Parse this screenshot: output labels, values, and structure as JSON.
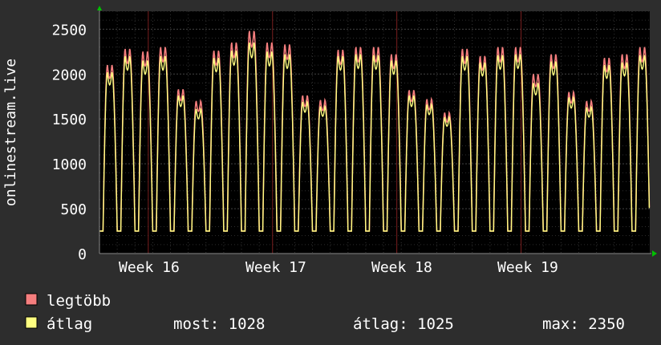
{
  "chart_data": {
    "type": "line",
    "ylabel": "onlinestream.live",
    "yticks": [
      0,
      500,
      1000,
      1500,
      2000,
      2500
    ],
    "ylim": [
      0,
      2700
    ],
    "week_labels": [
      "Week 16",
      "Week 17",
      "Week 18",
      "Week 19"
    ],
    "grid": true,
    "colors": {
      "background": "#2d2d2d",
      "plot_background": "#000000",
      "grid": "#3a3a3a",
      "week_divider": "#7a1f1f",
      "legtobb": "#f57e7e",
      "atlag": "#ffff80",
      "axis_arrow": "#00c000"
    },
    "series": [
      {
        "name": "legtöbb",
        "color": "#f57e7e",
        "daily_peaks": [
          2100,
          2280,
          2250,
          2300,
          1830,
          1700,
          2260,
          2350,
          2480,
          2350,
          2330,
          1760,
          1710,
          2270,
          2300,
          2300,
          2220,
          1820,
          1720,
          1570,
          2280,
          2200,
          2300,
          2300,
          2000,
          2220,
          1800,
          1700,
          2180,
          2220,
          2300
        ]
      },
      {
        "name": "átlag",
        "color": "#ffff80",
        "daily_peaks": [
          2020,
          2200,
          2150,
          2200,
          1760,
          1610,
          2180,
          2260,
          2350,
          2250,
          2220,
          1690,
          1640,
          2200,
          2220,
          2210,
          2150,
          1760,
          1660,
          1520,
          2200,
          2130,
          2210,
          2220,
          1900,
          2140,
          1740,
          1630,
          2100,
          2130,
          2210
        ]
      }
    ]
  },
  "legend": [
    {
      "label": "legtöbb",
      "color": "#f57e7e"
    },
    {
      "label": "átlag",
      "color": "#ffff80"
    }
  ],
  "stats": {
    "most": "most: 1028",
    "atlag": "átlag: 1025",
    "max": "max: 2350"
  }
}
